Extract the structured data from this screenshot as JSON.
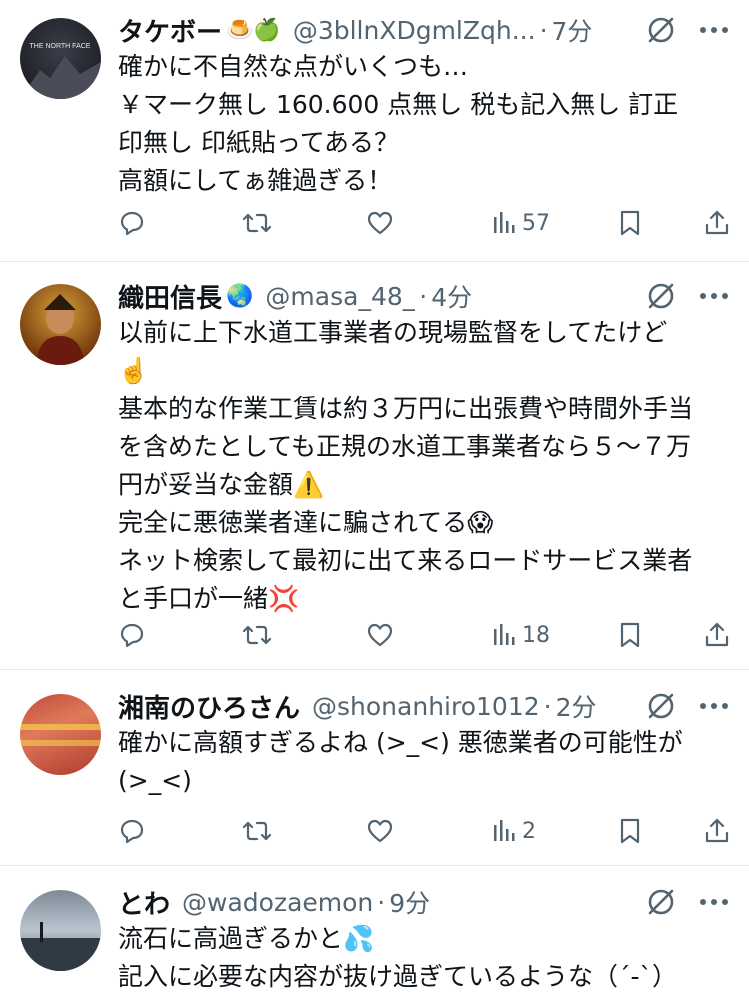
{
  "colors": {
    "text": "#0f1419",
    "secondary": "#536471",
    "divider": "#e6e9ec"
  },
  "tweets": [
    {
      "name": "タケボー",
      "emojis": "🍮🍏",
      "handle": "@3bllnXDgmlZqh...",
      "sep": "·",
      "time": "7分",
      "lines": [
        "確かに不自然な点がいくつも…",
        "￥マーク無し  160.600 点無し  税も記入無し  訂正",
        "印無し  印紙貼ってある？",
        "高額にしてぁ雑過ぎる！"
      ],
      "views": "57",
      "avatar_text": "THE NORTH FACE"
    },
    {
      "name": "織田信長",
      "emojis": "🌏",
      "handle": "@masa_48_",
      "sep": "·",
      "time": "4分",
      "lines": [
        "以前に上下水道工事業者の現場監督をしてたけど",
        "☝️",
        "基本的な作業工賃は約３万円に出張費や時間外手当",
        "を含めたとしても正規の水道工事業者なら５～７万",
        "円が妥当な金額⚠️",
        "完全に悪徳業者達に騙されてる😱",
        "ネット検索して最初に出て来るロードサービス業者",
        "と手口が一緒💢"
      ],
      "views": "18"
    },
    {
      "name": "湘南のひろさん",
      "emojis": "",
      "handle": "@shonanhiro1012",
      "sep": "·",
      "time": "2分",
      "lines": [
        "確かに高額すぎるよね (>_<) 悪徳業者の可能性が",
        "(>_<)"
      ],
      "views": "2"
    },
    {
      "name": "とわ",
      "emojis": "",
      "handle": "@wadozaemon",
      "sep": "·",
      "time": "9分",
      "lines": [
        "流石に高過ぎるかと💦",
        "記入に必要な内容が抜け過ぎているような（´-`）"
      ],
      "views": ""
    }
  ]
}
